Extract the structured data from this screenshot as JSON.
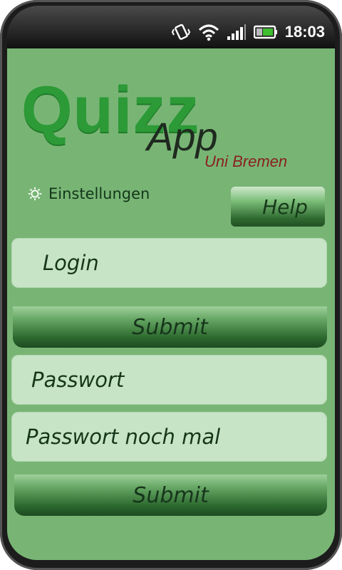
{
  "status_bar": {
    "time": "18:03",
    "icons": [
      "vibrate-icon",
      "wifi-icon",
      "signal-icon",
      "battery-icon"
    ]
  },
  "logo": {
    "title": "Quizz",
    "subtitle": "App",
    "tagline": "Uni Bremen"
  },
  "settings": {
    "label": "Einstellungen",
    "icon": "gear-icon"
  },
  "help": {
    "label": "Help"
  },
  "login_form": {
    "login_label": "Login",
    "submit_label": "Submit"
  },
  "password_form": {
    "password_label": "Passwort",
    "password_repeat_label": "Passwort noch mal",
    "submit_label": "Submit"
  },
  "colors": {
    "background": "#78b575",
    "logo_green": "#2c9a36",
    "tagline_red": "#8a1f1f",
    "field": "#c7e5c6",
    "button_dark": "#1d4a20"
  }
}
